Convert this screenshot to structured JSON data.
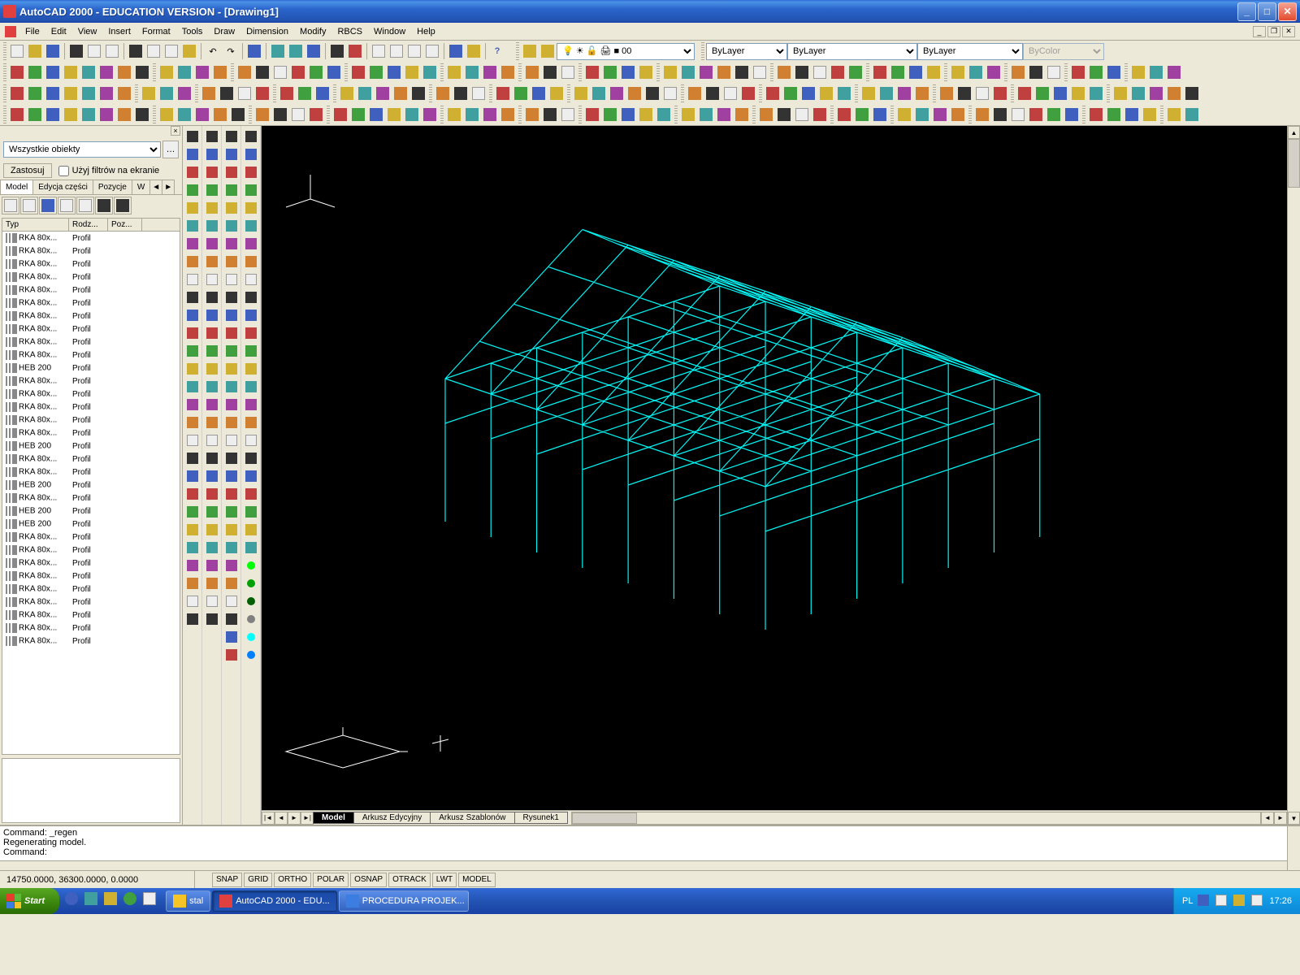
{
  "titlebar": {
    "title": "AutoCAD 2000 - EDUCATION VERSION - [Drawing1]"
  },
  "menu": {
    "items": [
      "File",
      "Edit",
      "View",
      "Insert",
      "Format",
      "Tools",
      "Draw",
      "Dimension",
      "Modify",
      "RBCS",
      "Window",
      "Help"
    ]
  },
  "layer_controls": {
    "layer_combo": "0",
    "color_combo": "ByLayer",
    "linetype_combo": "ByLayer",
    "lineweight_combo": "ByLayer",
    "plotstyle_combo": "ByColor"
  },
  "leftpanel": {
    "filter_combo": "Wszystkie obiekty",
    "apply_btn": "Zastosuj",
    "use_filters_check": "Użyj filtrów na ekranie",
    "tabs": [
      "Model",
      "Edycja części",
      "Pozycje",
      "W"
    ],
    "columns": {
      "typ": "Typ",
      "rodz": "Rodz...",
      "poz": "Poz..."
    },
    "rows": [
      {
        "typ": "RKA 80x...",
        "rodz": "Profil",
        "poz": ""
      },
      {
        "typ": "RKA 80x...",
        "rodz": "Profil",
        "poz": ""
      },
      {
        "typ": "RKA 80x...",
        "rodz": "Profil",
        "poz": ""
      },
      {
        "typ": "RKA 80x...",
        "rodz": "Profil",
        "poz": ""
      },
      {
        "typ": "RKA 80x...",
        "rodz": "Profil",
        "poz": ""
      },
      {
        "typ": "RKA 80x...",
        "rodz": "Profil",
        "poz": ""
      },
      {
        "typ": "RKA 80x...",
        "rodz": "Profil",
        "poz": ""
      },
      {
        "typ": "RKA 80x...",
        "rodz": "Profil",
        "poz": ""
      },
      {
        "typ": "RKA 80x...",
        "rodz": "Profil",
        "poz": ""
      },
      {
        "typ": "RKA 80x...",
        "rodz": "Profil",
        "poz": ""
      },
      {
        "typ": "HEB 200",
        "rodz": "Profil",
        "poz": ""
      },
      {
        "typ": "RKA 80x...",
        "rodz": "Profil",
        "poz": ""
      },
      {
        "typ": "RKA 80x...",
        "rodz": "Profil",
        "poz": ""
      },
      {
        "typ": "RKA 80x...",
        "rodz": "Profil",
        "poz": ""
      },
      {
        "typ": "RKA 80x...",
        "rodz": "Profil",
        "poz": ""
      },
      {
        "typ": "RKA 80x...",
        "rodz": "Profil",
        "poz": ""
      },
      {
        "typ": "HEB 200",
        "rodz": "Profil",
        "poz": ""
      },
      {
        "typ": "RKA 80x...",
        "rodz": "Profil",
        "poz": ""
      },
      {
        "typ": "RKA 80x...",
        "rodz": "Profil",
        "poz": ""
      },
      {
        "typ": "HEB 200",
        "rodz": "Profil",
        "poz": ""
      },
      {
        "typ": "RKA 80x...",
        "rodz": "Profil",
        "poz": ""
      },
      {
        "typ": "HEB 200",
        "rodz": "Profil",
        "poz": ""
      },
      {
        "typ": "HEB 200",
        "rodz": "Profil",
        "poz": ""
      },
      {
        "typ": "RKA 80x...",
        "rodz": "Profil",
        "poz": ""
      },
      {
        "typ": "RKA 80x...",
        "rodz": "Profil",
        "poz": ""
      },
      {
        "typ": "RKA 80x...",
        "rodz": "Profil",
        "poz": ""
      },
      {
        "typ": "RKA 80x...",
        "rodz": "Profil",
        "poz": ""
      },
      {
        "typ": "RKA 80x...",
        "rodz": "Profil",
        "poz": ""
      },
      {
        "typ": "RKA 80x...",
        "rodz": "Profil",
        "poz": ""
      },
      {
        "typ": "RKA 80x...",
        "rodz": "Profil",
        "poz": ""
      },
      {
        "typ": "RKA 80x...",
        "rodz": "Profil",
        "poz": ""
      },
      {
        "typ": "RKA 80x...",
        "rodz": "Profil",
        "poz": ""
      }
    ]
  },
  "viewport_tabs": {
    "tabs": [
      {
        "name": "Model",
        "active": true
      },
      {
        "name": "Arkusz Edycyjny",
        "active": false
      },
      {
        "name": "Arkusz Szablonów",
        "active": false
      },
      {
        "name": "Rysunek1",
        "active": false
      }
    ]
  },
  "command": {
    "lines": [
      "Command: _regen",
      "Regenerating model.",
      "Command:"
    ]
  },
  "statusbar": {
    "coords": "14750.0000, 36300.0000, 0.0000",
    "toggles": [
      "SNAP",
      "GRID",
      "ORTHO",
      "POLAR",
      "OSNAP",
      "OTRACK",
      "LWT",
      "MODEL"
    ]
  },
  "taskbar": {
    "start": "Start",
    "tasks": [
      {
        "label": "stal",
        "icon": "folder"
      },
      {
        "label": "AutoCAD 2000 - EDU...",
        "icon": "acad",
        "active": true
      },
      {
        "label": "PROCEDURA PROJEK...",
        "icon": "word"
      }
    ],
    "lang": "PL",
    "time": "17:26"
  },
  "structure_color": "#00ffff"
}
